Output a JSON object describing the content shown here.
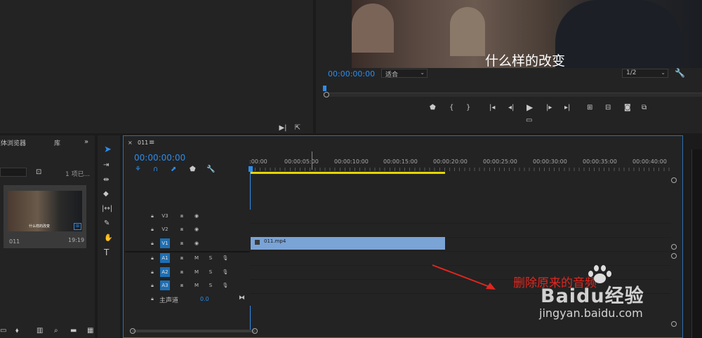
{
  "program_monitor": {
    "timecode": "00:00:00:00",
    "fit": "适合",
    "resolution": "1/2",
    "subtitle": "什么样的改变"
  },
  "transport": [
    "marker-icon",
    "mark-in-icon",
    "mark-out-icon",
    "go-to-in-icon",
    "step-back-icon",
    "play-icon",
    "step-forward-icon",
    "go-to-out-icon",
    "lift-icon",
    "extract-icon",
    "export-frame-icon",
    "compare-icon"
  ],
  "project_panel": {
    "tab_browser": "媒体浏览器",
    "tab_library": "库",
    "item_count": "1 项已...",
    "clip_name": "011",
    "clip_duration": "19:19",
    "thumb_caption": "什么样的改变"
  },
  "timeline": {
    "sequence_name": "011",
    "timecode": "00:00:00:00",
    "ruler": [
      ":00:00",
      "00:00:05:00",
      "00:00:10:00",
      "00:00:15:00",
      "00:00:20:00",
      "00:00:25:00",
      "00:00:30:00",
      "00:00:35:00",
      "00:00:40:00"
    ],
    "video_tracks": [
      "V3",
      "V2",
      "V1"
    ],
    "audio_tracks": [
      "A1",
      "A2",
      "A3"
    ],
    "mute_label": "M",
    "solo_label": "S",
    "master_label": "主声道",
    "master_value": "0.0",
    "clip_label": "011.mp4"
  },
  "annotation": {
    "text": "删除原来的音频",
    "color": "#e0261f"
  },
  "watermark": {
    "brand": "Baidu经验",
    "url": "jingyan.baidu.com"
  },
  "colors": {
    "accent": "#2d8ceb",
    "clip": "#7aa3d6",
    "work_area": "#e5d500"
  }
}
